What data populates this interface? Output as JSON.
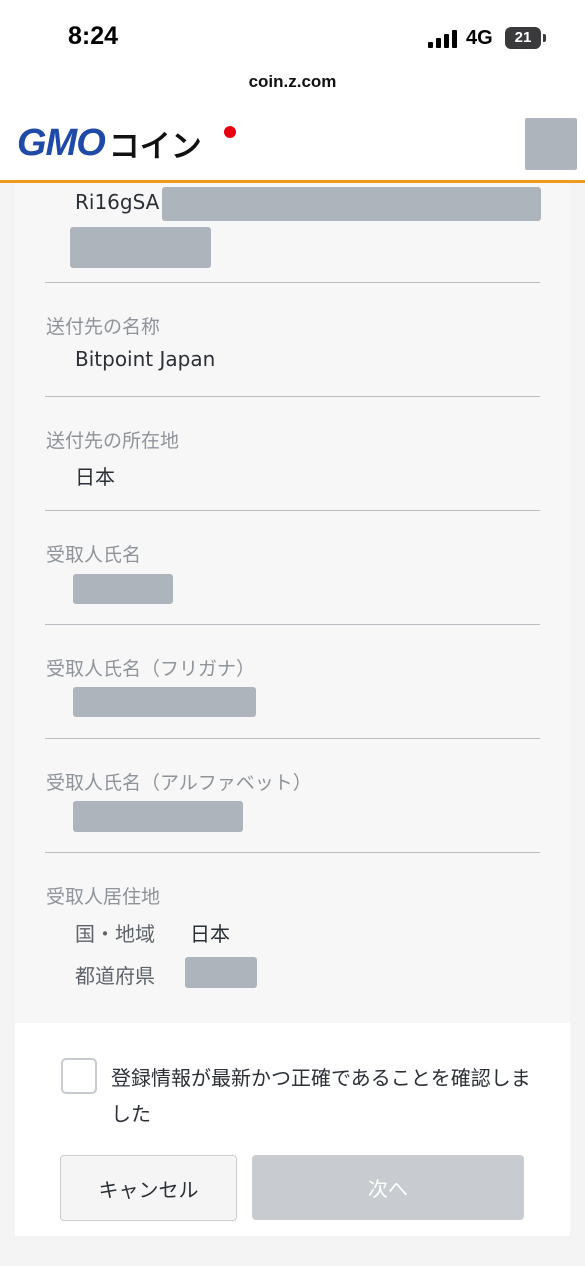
{
  "status_bar": {
    "time": "8:24",
    "network": "4G",
    "battery": "21"
  },
  "browser": {
    "url": "coin.z.com"
  },
  "header": {
    "logo_gmo": "GMO",
    "logo_coin": "コイン"
  },
  "address": {
    "partial": "Ri16gSA"
  },
  "fields": [
    {
      "label": "送付先の名称",
      "value": "Bitpoint Japan"
    },
    {
      "label": "送付先の所在地",
      "value": "日本"
    },
    {
      "label": "受取人氏名"
    },
    {
      "label": "受取人氏名（フリガナ）"
    },
    {
      "label": "受取人氏名（アルファベット）"
    },
    {
      "label": "受取人居住地"
    }
  ],
  "residence": {
    "country_label": "国・地域",
    "country_value": "日本",
    "prefecture_label": "都道府県"
  },
  "confirm": {
    "text": "登録情報が最新かつ正確であることを確認しました",
    "checked": false
  },
  "buttons": {
    "cancel": "キャンセル",
    "next": "次へ"
  },
  "colors": {
    "accent": "#f29a1f",
    "brand_blue": "#1f4aa8",
    "brand_red": "#e60012",
    "redacted": "#adb4bc"
  }
}
